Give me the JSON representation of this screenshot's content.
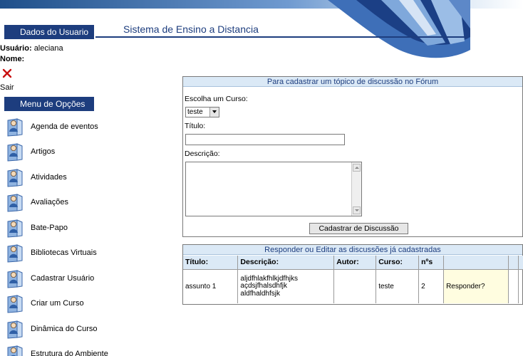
{
  "sidebar": {
    "dados_header": "Dados do Usuario",
    "usuario_label": "Usuário:",
    "usuario_value": "aleciana",
    "nome_label": "Nome:",
    "sair_label": "Sair",
    "menu_header": "Menu de Opções",
    "menu_items": [
      {
        "label": "Agenda de eventos"
      },
      {
        "label": "Artigos"
      },
      {
        "label": "Atividades"
      },
      {
        "label": "Avaliações"
      },
      {
        "label": "Bate-Papo"
      },
      {
        "label": "Bibliotecas Virtuais"
      },
      {
        "label": "Cadastrar Usuário"
      },
      {
        "label": "Criar um Curso"
      },
      {
        "label": "Dinâmica do Curso"
      },
      {
        "label": "Estrutura do Ambiente"
      }
    ]
  },
  "header": {
    "app_title": "Sistema de Ensino a Distancia"
  },
  "form": {
    "panel_title": "Para cadastrar um tópico de discussão no Fórum",
    "course_label": "Escolha um Curso:",
    "course_selected": "teste",
    "title_label": "Título:",
    "title_value": "",
    "description_label": "Descrição:",
    "description_value": "",
    "submit_label": "Cadastrar de Discussão"
  },
  "discussions": {
    "panel_title": "Responder ou Editar as discussões já cadastradas",
    "columns": [
      "Título:",
      "Descrição:",
      "Autor:",
      "Curso:",
      "nºs",
      "",
      "",
      ""
    ],
    "rows": [
      {
        "titulo": "assunto 1",
        "descricao": [
          "aljdfhlakfhlkjdfhjks",
          "açdsjfhalsdhfjk",
          "aldfhaldhfsjk"
        ],
        "autor": "",
        "curso": "teste",
        "numero": "2",
        "acao": "Responder?"
      }
    ]
  },
  "colors": {
    "nav_header": "#1d3d7e",
    "panel_title_bg": "#dbe9f6",
    "panel_title_text": "#1d3d7e",
    "action_bg": "#fffde0"
  }
}
